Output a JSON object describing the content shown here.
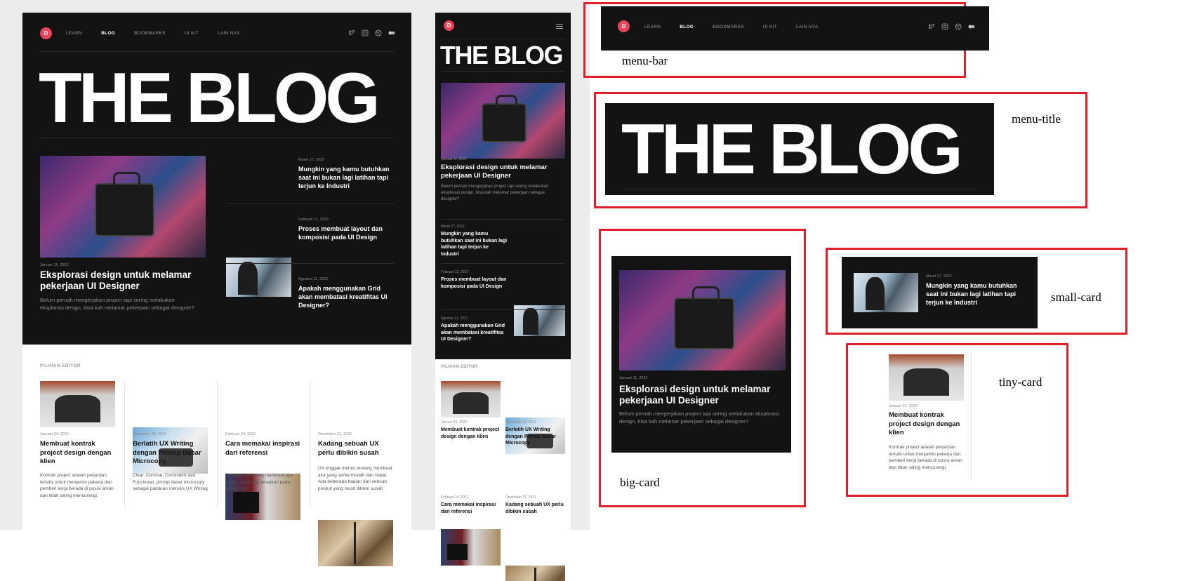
{
  "logo_letter": "D",
  "nav": [
    "LEARN",
    "BLOG",
    "BOOKMARKS",
    "UI KIT",
    "LAIN NYA"
  ],
  "social_icons": [
    "twitter-icon",
    "instagram-icon",
    "dribbble-icon",
    "medium-icon"
  ],
  "blog_title": "THE BLOG",
  "featured": {
    "date": "Januari 11, 2022",
    "title": "Eksplorasi design untuk melamar pekerjaan UI Designer",
    "excerpt": "Belum pernah mengerjakan project tapi sering melakukan eksplorasi design, bisa kah melamar pekerjaan sebagai designer?"
  },
  "side_posts": [
    {
      "date": "Maret 27, 2022",
      "title": "Mungkin yang kamu butuhkan saat ini bukan lagi latihan tapi terjun ke Industri"
    },
    {
      "date": "Februari 11, 2022",
      "title": "Proses membuat layout dan komposisi pada UI Design"
    },
    {
      "date": "Agustus 11, 2021",
      "title": "Apakah menggunakan Grid akan membatasi kreatifitas UI Designer?"
    }
  ],
  "editor_heading": "PILIHAN EDITOR",
  "editor_posts": [
    {
      "date": "Januari 24, 2022",
      "title": "Membuat kontrak project design dengan klien",
      "excerpt": "Kontrak project adalah perjanjian tertulis untuk menjamin pekerja dan pemberi kerja berada di posisi aman dan tidak saling mencurangi."
    },
    {
      "date": "Desember 20, 2021",
      "title": "Berlatih UX Writing dengan Prinsip Dasar Microcopy",
      "excerpt": "Clear, Concise, Consistent dan Functional, prinsip dasar microcopy sebagai panduan menulis UX Writing"
    },
    {
      "date": "Februari 24, 2021",
      "title": "Cara memakai inspirasi dari referensi",
      "excerpt": "Cari tahu apa yang membuat nya bagus, ambil lalu terapkan pada design mu."
    },
    {
      "date": "Desember 21, 2021",
      "title": "Kadang sebuah UX perlu dibikin susah",
      "excerpt": "UX enggak melulu tentang membuat alur yang serba mudah dan cepat. Ada beberapa bagian dari sebuah produk yang musti dibikin susah"
    }
  ],
  "annotations": {
    "menu_bar": "menu-bar",
    "menu_title": "menu-title",
    "big_card": "big-card",
    "small_card": "small-card",
    "tiny_card": "tiny-card"
  },
  "colors": {
    "accent": "#e8445c",
    "dark_bg": "#131313",
    "annotation": "#e01f2d"
  }
}
